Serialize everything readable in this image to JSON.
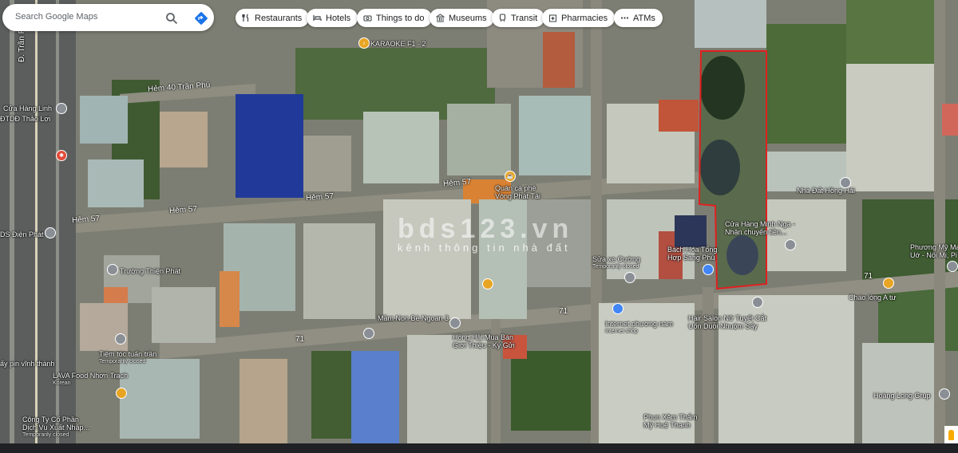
{
  "search": {
    "placeholder": "Search Google Maps"
  },
  "chips": [
    {
      "label": "Restaurants",
      "icon": "fork-knife-icon"
    },
    {
      "label": "Hotels",
      "icon": "bed-icon"
    },
    {
      "label": "Things to do",
      "icon": "camera-icon"
    },
    {
      "label": "Museums",
      "icon": "museum-icon"
    },
    {
      "label": "Transit",
      "icon": "train-icon"
    },
    {
      "label": "Pharmacies",
      "icon": "pharmacy-icon"
    },
    {
      "label": "ATMs",
      "icon": "more-icon"
    }
  ],
  "streets": {
    "tran_phu": "Đ. Trần Phú",
    "hem40": "Hẻm 40 Trần Phú",
    "hem57_a": "Hẻm 57",
    "hem57_b": "Hẻm 57",
    "hem57_c": "Hẻm 57",
    "hem57_d": "Hẻm 57",
    "n71_a": "71",
    "n71_b": "71",
    "n71_c": "71"
  },
  "pois": {
    "karaoke": "KARAOKE F1 - 2",
    "cua_hang_linh": "Cửa Hàng Linh",
    "dtdd": "ĐTDĐ Thảo Lợi",
    "dien_phat": "DS Điện Phát",
    "quan_ca_phe_1": "Quán cà phê",
    "quan_ca_phe_2": "Vòng Phát Tài",
    "truong_thien_phat": "Trường Thiện Phát",
    "minh_nga_1": "Cửa Hàng Minh Nga -",
    "minh_nga_2": "Nhận chuyển tiền...",
    "bach_hoa_1": "Bách Hóa Tổng",
    "bach_hoa_2": "Hợp Sáng Phú",
    "sua_xe": "Sửa xe Cường",
    "sua_xe_status": "Temporarily closed",
    "nha_dat": "Nhà Đất Hồng Hải",
    "phuong_my_1": "Phương Mỹ Ma",
    "phuong_my_2": "Uớ - Nối Mi, Pi",
    "chao_long": "Cháo lòng A tư",
    "mam_non": "Mầm Non Bé Ngoan 3",
    "internet": "Internet phương nam",
    "internet_sub": "Internet shop",
    "hair_1": "Hair Salon Nữ Tuyết Cắt",
    "hair_2": "Uốn Duỗi Nhuộm Sấy",
    "hong_hai_1": "Hồng Hải Mua Bán",
    "hong_hai_2": "Giới Thiệu - Ký Gửi",
    "tuan_tran": "Tiệm tóc tuấn trần",
    "tuan_tran_status": "Temporarily closed",
    "pin_vinh": "ấy pin vĩnh thành",
    "lava_1": "LAVA Food Nhơn Trạch",
    "lava_2": "Korean",
    "cong_ty_1": "Công Ty Cổ Phần",
    "cong_ty_2": "Dịch Vụ Xuất Nhập...",
    "cong_ty_status": "Temporarily closed",
    "phun_xam_1": "Phun Xăm Thẩm",
    "phun_xam_2": "Mỹ Huệ Thanh",
    "hoang_long": "Hoàng Long Grup"
  },
  "watermark": {
    "big": "bds123.vn",
    "small": "kênh thông tin nhà đất"
  },
  "colors": {
    "parcel_outline": "#e02020",
    "chip_bg": "#ffffff",
    "search_bg": "#ffffff",
    "directions_blue": "#1a73e8"
  }
}
